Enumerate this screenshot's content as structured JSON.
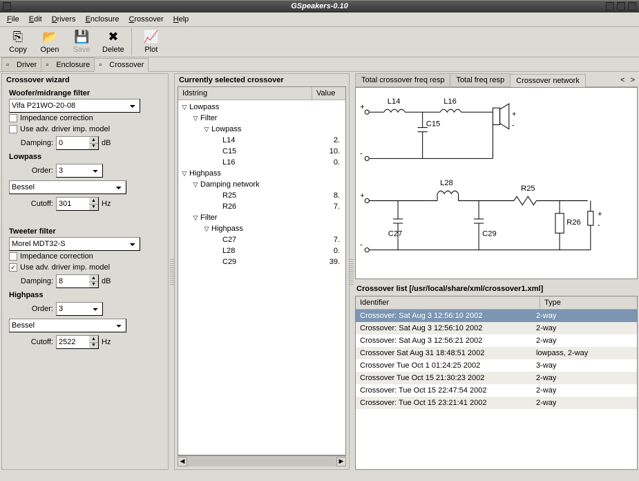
{
  "title": "GSpeakers-0.10",
  "menu": [
    "File",
    "Edit",
    "Drivers",
    "Enclosure",
    "Crossover",
    "Help"
  ],
  "toolbar": [
    {
      "label": "Copy",
      "key": "copy",
      "sep": false
    },
    {
      "label": "Open",
      "key": "open",
      "sep": false
    },
    {
      "label": "Save",
      "key": "save",
      "sep": false,
      "disabled": true
    },
    {
      "label": "Delete",
      "key": "delete",
      "sep": true
    },
    {
      "label": "Plot",
      "key": "plot",
      "sep": false
    }
  ],
  "tabs": {
    "items": [
      "Driver",
      "Enclosure",
      "Crossover"
    ],
    "active": 2
  },
  "wizard": {
    "title": "Crossover wizard",
    "woofer": {
      "title": "Woofer/midrange filter",
      "driver": "Vifa P21WO-20-08",
      "imp_corr_label": "Impedance correction",
      "imp_corr": false,
      "adv_model_label": "Use adv. driver imp. model",
      "adv_model": false,
      "damping_label": "Damping:",
      "damping": "0",
      "damping_unit": "dB",
      "lowpass_title": "Lowpass",
      "order_label": "Order:",
      "order": "3",
      "type": "Bessel",
      "cutoff_label": "Cutoff:",
      "cutoff": "301",
      "cutoff_unit": "Hz"
    },
    "tweeter": {
      "title": "Tweeter filter",
      "driver": "Morel MDT32-S",
      "imp_corr_label": "Impedance correction",
      "imp_corr": false,
      "adv_model_label": "Use adv. driver imp. model",
      "adv_model": true,
      "damping_label": "Damping:",
      "damping": "8",
      "damping_unit": "dB",
      "highpass_title": "Highpass",
      "order_label": "Order:",
      "order": "3",
      "type": "Bessel",
      "cutoff_label": "Cutoff:",
      "cutoff": "2522",
      "cutoff_unit": "Hz"
    }
  },
  "selected": {
    "title": "Currently selected crossover",
    "cols": {
      "id": "Idstring",
      "val": "Value"
    },
    "tree": [
      {
        "d": 0,
        "t": true,
        "label": "Lowpass",
        "val": ""
      },
      {
        "d": 1,
        "t": true,
        "label": "Filter",
        "val": ""
      },
      {
        "d": 2,
        "t": true,
        "label": "Lowpass",
        "val": ""
      },
      {
        "d": 3,
        "t": false,
        "label": "L14",
        "val": "2."
      },
      {
        "d": 3,
        "t": false,
        "label": "C15",
        "val": "10."
      },
      {
        "d": 3,
        "t": false,
        "label": "L16",
        "val": "0."
      },
      {
        "d": 0,
        "t": true,
        "label": "Highpass",
        "val": ""
      },
      {
        "d": 1,
        "t": true,
        "label": "Damping network",
        "val": ""
      },
      {
        "d": 3,
        "t": false,
        "label": "R25",
        "val": "8."
      },
      {
        "d": 3,
        "t": false,
        "label": "R26",
        "val": "7."
      },
      {
        "d": 1,
        "t": true,
        "label": "Filter",
        "val": ""
      },
      {
        "d": 2,
        "t": true,
        "label": "Highpass",
        "val": ""
      },
      {
        "d": 3,
        "t": false,
        "label": "C27",
        "val": "7."
      },
      {
        "d": 3,
        "t": false,
        "label": "L28",
        "val": "0."
      },
      {
        "d": 3,
        "t": false,
        "label": "C29",
        "val": "39."
      }
    ]
  },
  "rtabs": {
    "items": [
      "Total crossover freq resp",
      "Total freq resp",
      "Crossover network"
    ],
    "active": 2
  },
  "schem": {
    "labels": [
      "L14",
      "L16",
      "C15",
      "L28",
      "R25",
      "C27",
      "C29",
      "R26"
    ]
  },
  "xolist": {
    "title": "Crossover list [/usr/local/share/xml/crossover1.xml]",
    "cols": {
      "id": "Identifier",
      "type": "Type"
    },
    "rows": [
      {
        "id": "Crossover: Sat Aug  3 12:56:10 2002",
        "type": "2-way",
        "sel": true
      },
      {
        "id": "Crossover: Sat Aug  3 12:56:10 2002",
        "type": "2-way"
      },
      {
        "id": "Crossover: Sat Aug  3 12:56:21 2002",
        "type": "2-way"
      },
      {
        "id": "Crossover Sat Aug 31 18:48:51 2002",
        "type": "lowpass, 2-way"
      },
      {
        "id": "Crossover Tue Oct  1 01:24:25 2002",
        "type": "3-way"
      },
      {
        "id": "Crossover Tue Oct 15 21:30:23 2002",
        "type": "2-way"
      },
      {
        "id": "Crossover: Tue Oct 15 22:47:54 2002",
        "type": "2-way"
      },
      {
        "id": "Crossover: Tue Oct 15 23:21:41 2002",
        "type": "2-way"
      }
    ]
  }
}
